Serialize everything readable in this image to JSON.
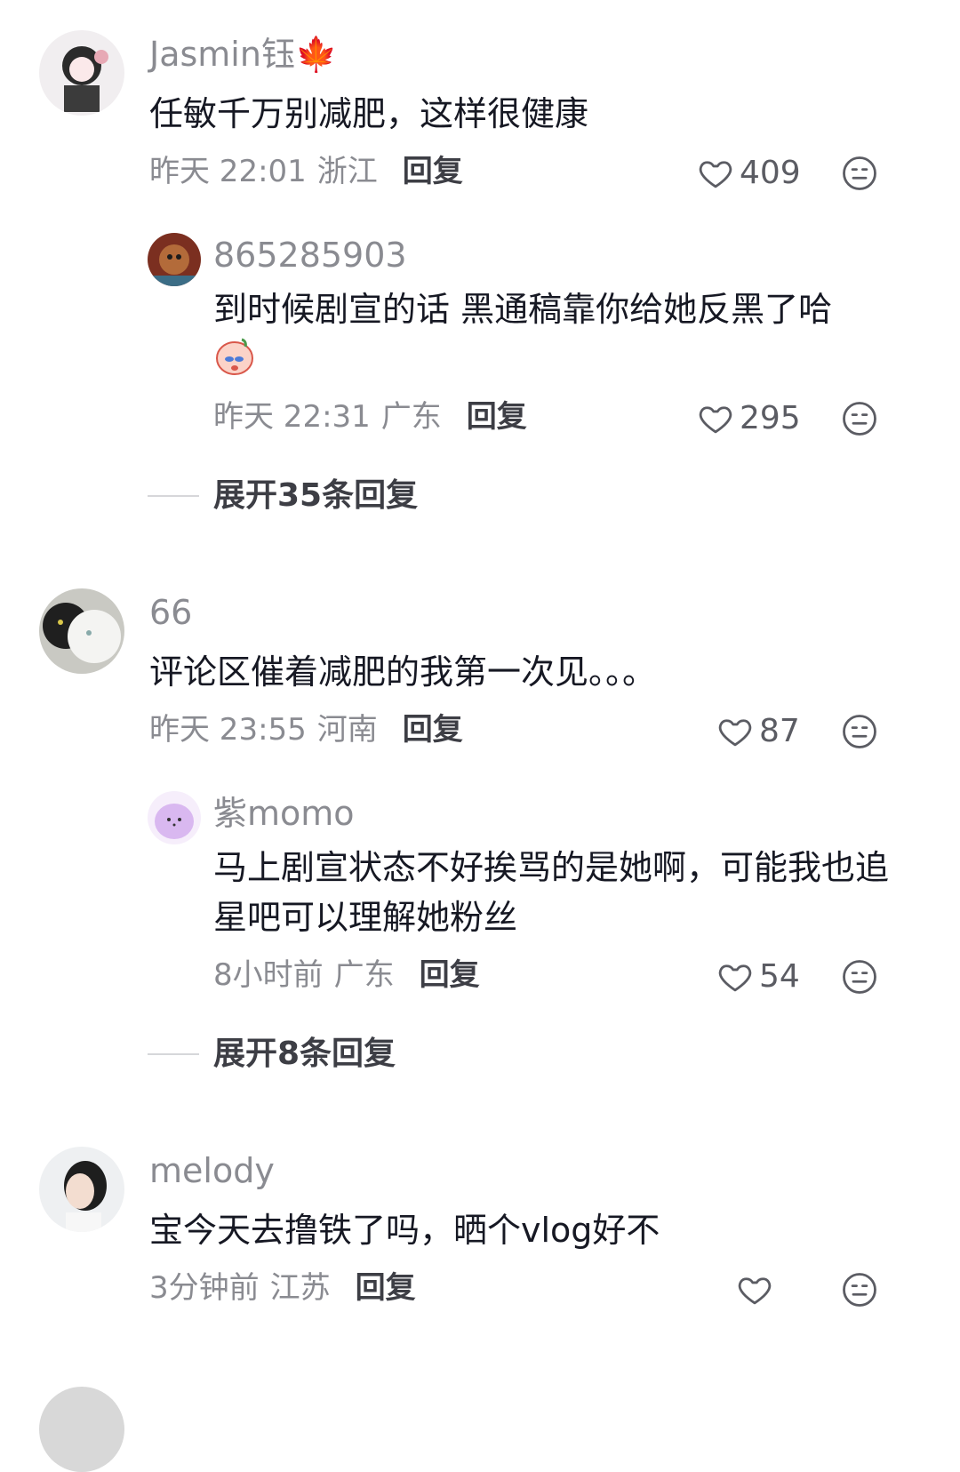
{
  "comments": [
    {
      "username": "Jasmin钰🍁",
      "text": "任敏千万别减肥，这样很健康",
      "time": "昨天 22:01",
      "location": "浙江",
      "reply_label": "回复",
      "likes": "409",
      "replies": [
        {
          "username": "865285903",
          "text": "到时候剧宣的话 黑通稿靠你给她反黑了哈",
          "time": "昨天 22:31",
          "location": "广东",
          "reply_label": "回复",
          "likes": "295"
        }
      ],
      "expand_label": "展开35条回复"
    },
    {
      "username": "66",
      "text": "评论区催着减肥的我第一次见。。。",
      "time": "昨天 23:55",
      "location": "河南",
      "reply_label": "回复",
      "likes": "87",
      "replies": [
        {
          "username": "紫momo",
          "text": "马上剧宣状态不好挨骂的是她啊，可能我也追星吧可以理解她粉丝",
          "time": "8小时前",
          "location": "广东",
          "reply_label": "回复",
          "likes": "54"
        }
      ],
      "expand_label": "展开8条回复"
    },
    {
      "username": "melody",
      "text": "宝今天去撸铁了吗，晒个vlog好不",
      "time": "3分钟前",
      "location": "江苏",
      "reply_label": "回复",
      "likes": ""
    }
  ],
  "icons": {
    "like": "heart-outline-icon",
    "dislike": "meh-face-icon"
  },
  "colors": {
    "name_gray": "#8a8b91",
    "text_dark": "#161823",
    "background": "#ffffff"
  }
}
